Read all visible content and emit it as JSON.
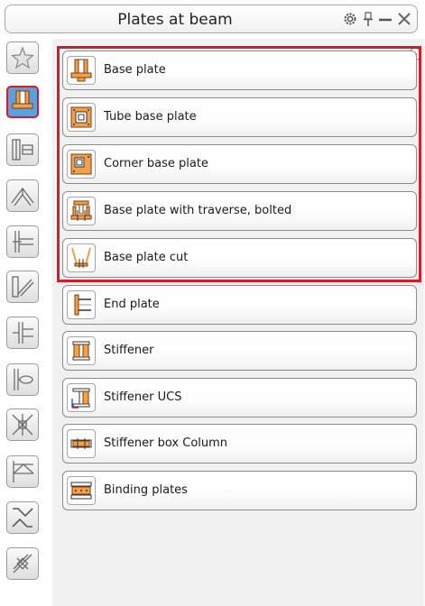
{
  "window": {
    "title": "Plates at beam"
  },
  "titlebar_icons": [
    "gear-icon",
    "pin-icon",
    "minimize-icon",
    "close-icon"
  ],
  "sidebar": {
    "items": [
      {
        "icon": "favorites-star-icon",
        "active": false
      },
      {
        "icon": "plates-at-beam-icon",
        "active": true
      },
      {
        "icon": "beam-connection-icon",
        "active": false
      },
      {
        "icon": "frame-apex-icon",
        "active": false
      },
      {
        "icon": "beam-column-joint-icon",
        "active": false
      },
      {
        "icon": "bracing-icon",
        "active": false
      },
      {
        "icon": "t-connection-icon",
        "active": false
      },
      {
        "icon": "pipe-connection-icon",
        "active": false
      },
      {
        "icon": "cross-bracing-icon",
        "active": false
      },
      {
        "icon": "truss-icon",
        "active": false
      },
      {
        "icon": "stair-icon",
        "active": false
      },
      {
        "icon": "tools-icon",
        "active": false
      }
    ]
  },
  "items": [
    {
      "label": "Base plate",
      "icon": "base-plate-icon",
      "highlighted": true
    },
    {
      "label": "Tube base plate",
      "icon": "tube-base-plate-icon",
      "highlighted": true
    },
    {
      "label": "Corner base plate",
      "icon": "corner-base-plate-icon",
      "highlighted": true
    },
    {
      "label": "Base plate with traverse, bolted",
      "icon": "base-plate-traverse-icon",
      "highlighted": true
    },
    {
      "label": "Base plate cut",
      "icon": "base-plate-cut-icon",
      "highlighted": true
    },
    {
      "label": "End plate",
      "icon": "end-plate-icon",
      "highlighted": false
    },
    {
      "label": "Stiffener",
      "icon": "stiffener-icon",
      "highlighted": false
    },
    {
      "label": "Stiffener UCS",
      "icon": "stiffener-ucs-icon",
      "highlighted": false
    },
    {
      "label": "Stiffener box Column",
      "icon": "stiffener-box-column-icon",
      "highlighted": false
    },
    {
      "label": "Binding plates",
      "icon": "binding-plates-icon",
      "highlighted": false
    }
  ],
  "colors": {
    "highlight": "#d51c2a",
    "active_tool": "#5aa0de",
    "plate_orange": "#f4a04a"
  }
}
